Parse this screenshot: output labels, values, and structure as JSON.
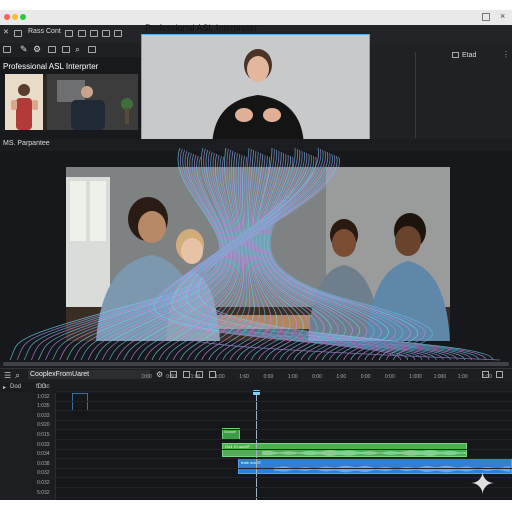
{
  "window": {
    "title": "Professional ASL Interpreter"
  },
  "toolbar": {
    "item1": "Rass",
    "item2": "Cont"
  },
  "right_panel": {
    "label": "Etad"
  },
  "left_panel": {
    "title": "Professional ASL Interprter"
  },
  "section": {
    "label": "MS. Parpantee"
  },
  "timeline": {
    "sequence_name": "CooplexFromUaret",
    "header": {
      "col1": "Dod",
      "col2": "fDD"
    },
    "ruler": [
      "0:00",
      "0:60",
      "1:00",
      "1:00",
      "1:60",
      "0:00",
      "1:00",
      "0:00",
      "1:00",
      "0:00",
      "0:00",
      "1:000",
      "1:000",
      "1:00",
      "1:00"
    ],
    "rows": [
      "1:150",
      "1:032",
      "1:035",
      "0:033",
      "0:920",
      "0:015",
      "0:033",
      "0:034",
      "0:038",
      "0:032",
      "0:032",
      "5:032"
    ],
    "clips": {
      "small_clip": "Gooce",
      "audio_clip_label": "Oo1 Gl ooc0F",
      "video_clip_label": "frate ooc0T"
    }
  },
  "colors": {
    "accent": "#4fb3d9",
    "audio_clip": "#4caf50",
    "video_clip": "#2f7fd6"
  }
}
